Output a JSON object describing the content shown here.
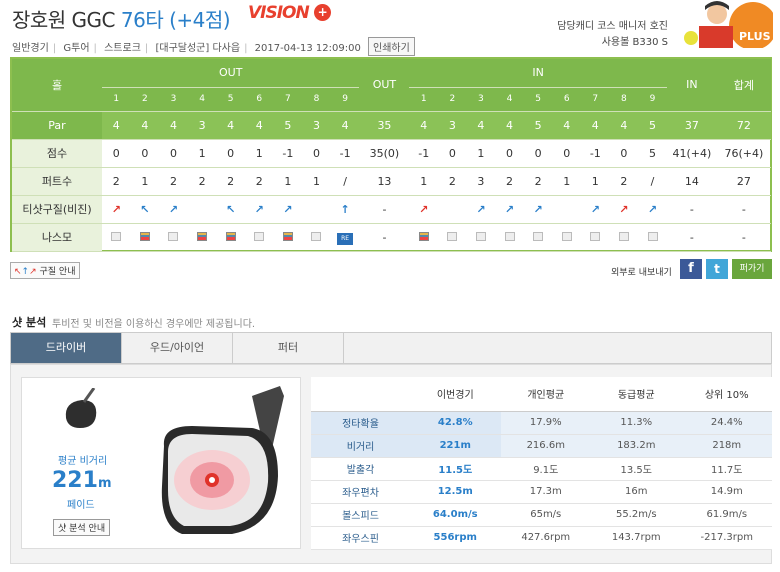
{
  "header": {
    "course": "장호원 GGC",
    "score": "76타 (+4점)",
    "logo_main": "VISION",
    "logo_plus": "+",
    "meta": [
      "일반경기",
      "G투어",
      "스트로크",
      "[대구달성군] 다사읍",
      "2017-04-13 12:09:00"
    ],
    "print_label": "인쇄하기",
    "caddy": "담당캐디 코스 매니저 호진",
    "ball": "사용볼 B330 S",
    "mascot_text": "PLUS"
  },
  "scorecard": {
    "hole_label": "홀",
    "out_label": "OUT",
    "in_label": "IN",
    "out_total_label": "OUT",
    "in_total_label": "IN",
    "total_label": "합계",
    "out_holes": [
      "1",
      "2",
      "3",
      "4",
      "5",
      "6",
      "7",
      "8",
      "9"
    ],
    "in_holes": [
      "1",
      "2",
      "3",
      "4",
      "5",
      "6",
      "7",
      "8",
      "9"
    ],
    "rows": [
      {
        "label": "Par",
        "out": [
          "4",
          "4",
          "4",
          "3",
          "4",
          "4",
          "5",
          "3",
          "4"
        ],
        "out_total": "35",
        "in": [
          "4",
          "3",
          "4",
          "4",
          "5",
          "4",
          "4",
          "4",
          "5"
        ],
        "in_total": "37",
        "total": "72"
      },
      {
        "label": "점수",
        "out": [
          "0",
          "0",
          "0",
          "1",
          "0",
          "1",
          "-1",
          "0",
          "-1"
        ],
        "out_total": "35(0)",
        "in": [
          "-1",
          "0",
          "1",
          "0",
          "0",
          "0",
          "-1",
          "0",
          "5"
        ],
        "in_total": "41(+4)",
        "total": "76(+4)"
      },
      {
        "label": "퍼트수",
        "out": [
          "2",
          "1",
          "2",
          "2",
          "2",
          "2",
          "1",
          "1",
          "/"
        ],
        "out_total": "13",
        "in": [
          "1",
          "2",
          "3",
          "2",
          "2",
          "1",
          "1",
          "2",
          "/"
        ],
        "in_total": "14",
        "total": "27"
      },
      {
        "label": "티샷구질(비진)",
        "out": [
          "↗",
          "↖",
          "↗",
          "",
          "↖",
          "↗",
          "↗",
          "",
          "↑"
        ],
        "out_total": "-",
        "in": [
          "↗",
          "",
          "↗",
          "↗",
          "↗",
          "",
          "↗",
          "↗",
          "↗"
        ],
        "in_total": "-",
        "total": "-"
      },
      {
        "label": "나스모",
        "out": [
          "",
          "",
          "",
          "",
          "",
          "",
          "",
          "",
          "RE"
        ],
        "out_total": "-",
        "in": [
          "",
          "",
          "",
          "",
          "",
          "",
          "",
          "",
          ""
        ],
        "in_total": "-",
        "total": "-"
      }
    ]
  },
  "actions": {
    "link_label": "구질 안내",
    "export_label": "외부로 내보내기",
    "fb": "f",
    "tw": "t",
    "copy_label": "퍼가기"
  },
  "shot_analysis": {
    "title": "샷 분석",
    "desc": "투비전 및 비전을 이용하신 경우에만 제공됩니다.",
    "tabs": [
      "드라이버",
      "우드/아이언",
      "퍼터"
    ],
    "avg_label": "평균 비거리",
    "avg_value": "221",
    "avg_unit": "m",
    "shape": "페이드",
    "guide_label": "샷 분석 안내",
    "columns": [
      "이번경기",
      "개인평균",
      "동급평균",
      "상위 10%"
    ],
    "rows": [
      {
        "label": "정타확율",
        "values": [
          "42.8%",
          "17.9%",
          "11.3%",
          "24.4%"
        ]
      },
      {
        "label": "비거리",
        "values": [
          "221m",
          "216.6m",
          "183.2m",
          "218m"
        ]
      },
      {
        "label": "발출각",
        "values": [
          "11.5도",
          "9.1도",
          "13.5도",
          "11.7도"
        ]
      },
      {
        "label": "좌우편차",
        "values": [
          "12.5m",
          "17.3m",
          "16m",
          "14.9m"
        ]
      },
      {
        "label": "볼스피드",
        "values": [
          "64.0m/s",
          "65m/s",
          "55.2m/s",
          "61.9m/s"
        ]
      },
      {
        "label": "좌우스핀",
        "values": [
          "556rpm",
          "427.6rpm",
          "143.7rpm",
          "-217.3rpm"
        ]
      }
    ]
  }
}
